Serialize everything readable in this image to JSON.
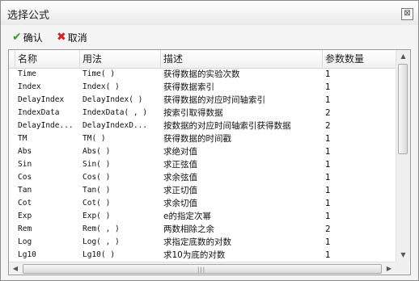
{
  "window": {
    "title": "选择公式",
    "close_glyph": "⊠"
  },
  "toolbar": {
    "ok_label": "确认",
    "ok_icon": "check-icon",
    "cancel_label": "取消",
    "cancel_icon": "x-icon"
  },
  "table": {
    "columns": [
      "名称",
      "用法",
      "描述",
      "参数数量"
    ],
    "rows": [
      {
        "name": "Time",
        "usage": "Time( )",
        "desc": "获得数据的实验次数",
        "count": "1"
      },
      {
        "name": "Index",
        "usage": "Index( )",
        "desc": "获得数据索引",
        "count": "1"
      },
      {
        "name": "DelayIndex",
        "usage": "DelayIndex( )",
        "desc": "获得数据的对应时间轴索引",
        "count": "1"
      },
      {
        "name": "IndexData",
        "usage": "IndexData( , )",
        "desc": "按索引取得数据",
        "count": "2"
      },
      {
        "name": "DelayInde...",
        "usage": "DelayIndexD...",
        "desc": "按数据的对应时间轴索引获得数据",
        "count": "2"
      },
      {
        "name": "TM",
        "usage": "TM( )",
        "desc": "获得数据的时间戳",
        "count": "1"
      },
      {
        "name": "Abs",
        "usage": "Abs( )",
        "desc": "求绝对值",
        "count": "1"
      },
      {
        "name": "Sin",
        "usage": "Sin( )",
        "desc": "求正弦值",
        "count": "1"
      },
      {
        "name": "Cos",
        "usage": "Cos( )",
        "desc": "求余弦值",
        "count": "1"
      },
      {
        "name": "Tan",
        "usage": "Tan( )",
        "desc": "求正切值",
        "count": "1"
      },
      {
        "name": "Cot",
        "usage": "Cot( )",
        "desc": "求余切值",
        "count": "1"
      },
      {
        "name": "Exp",
        "usage": "Exp( )",
        "desc": "e的指定次幂",
        "count": "1"
      },
      {
        "name": "Rem",
        "usage": "Rem( , )",
        "desc": "两数相除之余",
        "count": "2"
      },
      {
        "name": "Log",
        "usage": "Log( , )",
        "desc": "求指定底数的对数",
        "count": "1"
      },
      {
        "name": "Lg10",
        "usage": "Lg10( )",
        "desc": "求10为底的对数",
        "count": "1"
      }
    ]
  }
}
